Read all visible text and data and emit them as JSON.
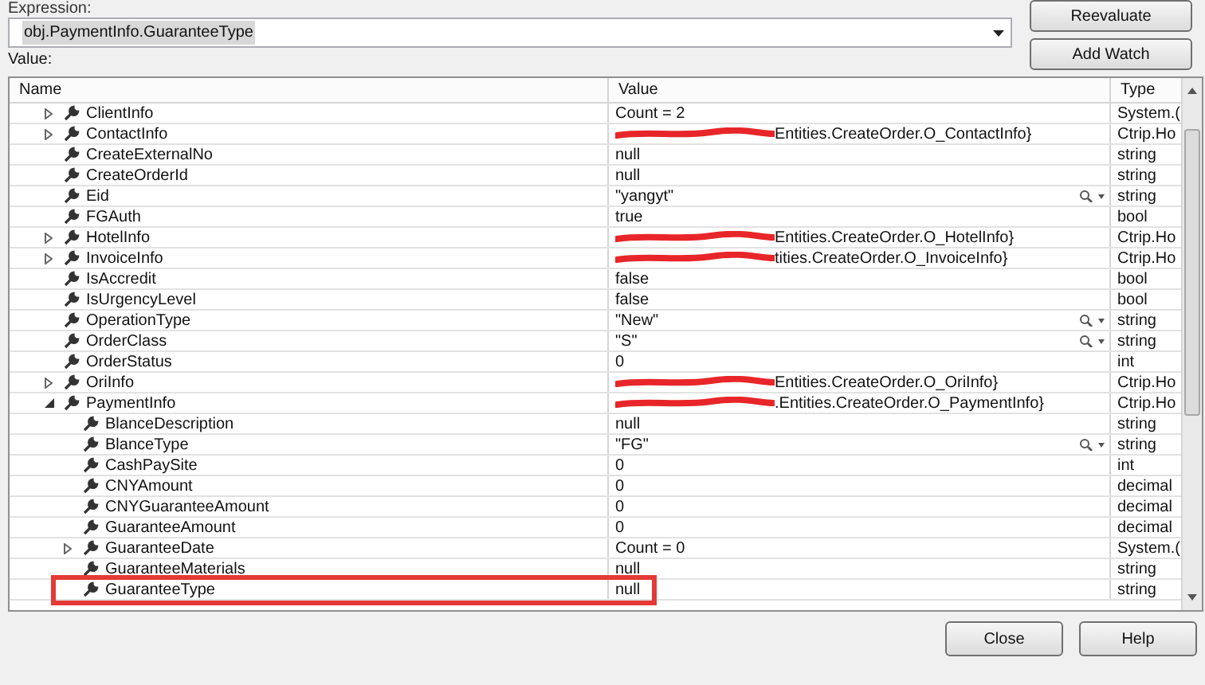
{
  "expression": {
    "label": "Expression:",
    "value": "obj.PaymentInfo.GuaranteeType"
  },
  "buttons": [
    {
      "label": "Reevaluate",
      "kind": "side"
    },
    {
      "label": "Add Watch",
      "kind": "side"
    },
    {
      "label": "Close",
      "kind": "bottom"
    },
    {
      "label": "Help",
      "kind": "bottom"
    }
  ],
  "value_label": "Value:",
  "table": {
    "columns": [
      "Name",
      "Value",
      "Type"
    ],
    "rows": [
      {
        "name": "ClientInfo",
        "value": "Count = 2",
        "type": "System.(",
        "expanded": false
      },
      {
        "name": "ContactInfo",
        "value": "Entities.CreateOrder.O_ContactInfo}",
        "type": "Ctrip.Ho",
        "expanded": false,
        "redacted": true
      },
      {
        "name": "CreateExternalNo",
        "value": "null",
        "type": "string"
      },
      {
        "name": "CreateOrderId",
        "value": "null",
        "type": "string"
      },
      {
        "name": "Eid",
        "value": "\"yangyt\"",
        "type": "string",
        "visualizer": true
      },
      {
        "name": "FGAuth",
        "value": "true",
        "type": "bool"
      },
      {
        "name": "HotelInfo",
        "value": "Entities.CreateOrder.O_HotelInfo}",
        "type": "Ctrip.Ho",
        "expanded": false,
        "redacted": true
      },
      {
        "name": "InvoiceInfo",
        "value": "tities.CreateOrder.O_InvoiceInfo}",
        "type": "Ctrip.Ho",
        "expanded": false,
        "redacted": true
      },
      {
        "name": "IsAccredit",
        "value": "false",
        "type": "bool"
      },
      {
        "name": "IsUrgencyLevel",
        "value": "false",
        "type": "bool"
      },
      {
        "name": "OperationType",
        "value": "\"New\"",
        "type": "string",
        "visualizer": true
      },
      {
        "name": "OrderClass",
        "value": "\"S\"",
        "type": "string",
        "visualizer": true
      },
      {
        "name": "OrderStatus",
        "value": "0",
        "type": "int"
      },
      {
        "name": "OriInfo",
        "value": "Entities.CreateOrder.O_OriInfo}",
        "type": "Ctrip.Ho",
        "expanded": false,
        "redacted": true
      },
      {
        "name": "PaymentInfo",
        "value": ".Entities.CreateOrder.O_PaymentInfo}",
        "type": "Ctrip.Ho",
        "expanded": true,
        "redacted": true,
        "children": [
          {
            "name": "BlanceDescription",
            "value": "null",
            "type": "string"
          },
          {
            "name": "BlanceType",
            "value": "\"FG\"",
            "type": "string",
            "visualizer": true
          },
          {
            "name": "CashPaySite",
            "value": "0",
            "type": "int"
          },
          {
            "name": "CNYAmount",
            "value": "0",
            "type": "decimal"
          },
          {
            "name": "CNYGuaranteeAmount",
            "value": "0",
            "type": "decimal"
          },
          {
            "name": "GuaranteeAmount",
            "value": "0",
            "type": "decimal"
          },
          {
            "name": "GuaranteeDate",
            "value": "Count = 0",
            "type": "System.(",
            "expanded": false
          },
          {
            "name": "GuaranteeMaterials",
            "value": "null",
            "type": "string"
          },
          {
            "name": "GuaranteeType",
            "value": "null",
            "type": "string",
            "highlighted": true
          }
        ]
      }
    ]
  }
}
